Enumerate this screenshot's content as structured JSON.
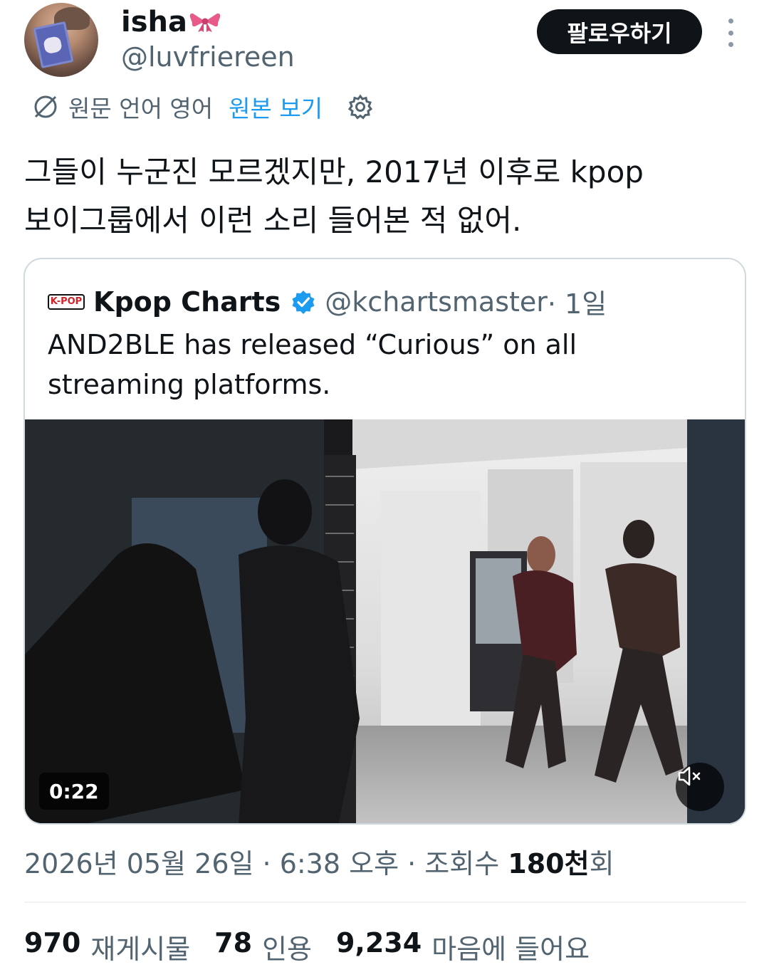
{
  "author": {
    "display_name": "isha",
    "handle": "@luvfriereen",
    "follow_label": "팔로우하기"
  },
  "translation": {
    "label": "원문 언어 영어",
    "view_original": "원본 보기"
  },
  "tweet": {
    "line1": "그들이 누군진 모르겠지만, 2017년 이후로 kpop",
    "line2": "보이그룹에서 이런 소리 들어본 적 없어."
  },
  "quote": {
    "logo_text": "K-POP",
    "name": "Kpop Charts",
    "handle": "@kchartsmaster",
    "time": " · 1일",
    "text": "AND2BLE has released “Curious” on all streaming platforms.",
    "video_duration": "0:22"
  },
  "meta": {
    "date": "2026년 05월 26일",
    "time": "6:38 오후",
    "views_prefix": "조회수 ",
    "views_num": "180천",
    "views_suffix": "회"
  },
  "stats": {
    "reposts_num": "970",
    "reposts_label": "재게시물",
    "quotes_num": "78",
    "quotes_label": "인용",
    "likes_num": "9,234",
    "likes_label": "마음에 들어요"
  },
  "colors": {
    "accent": "#1d9bf0",
    "text": "#0f1419",
    "secondary": "#536471",
    "bow": "#e85a8a"
  }
}
